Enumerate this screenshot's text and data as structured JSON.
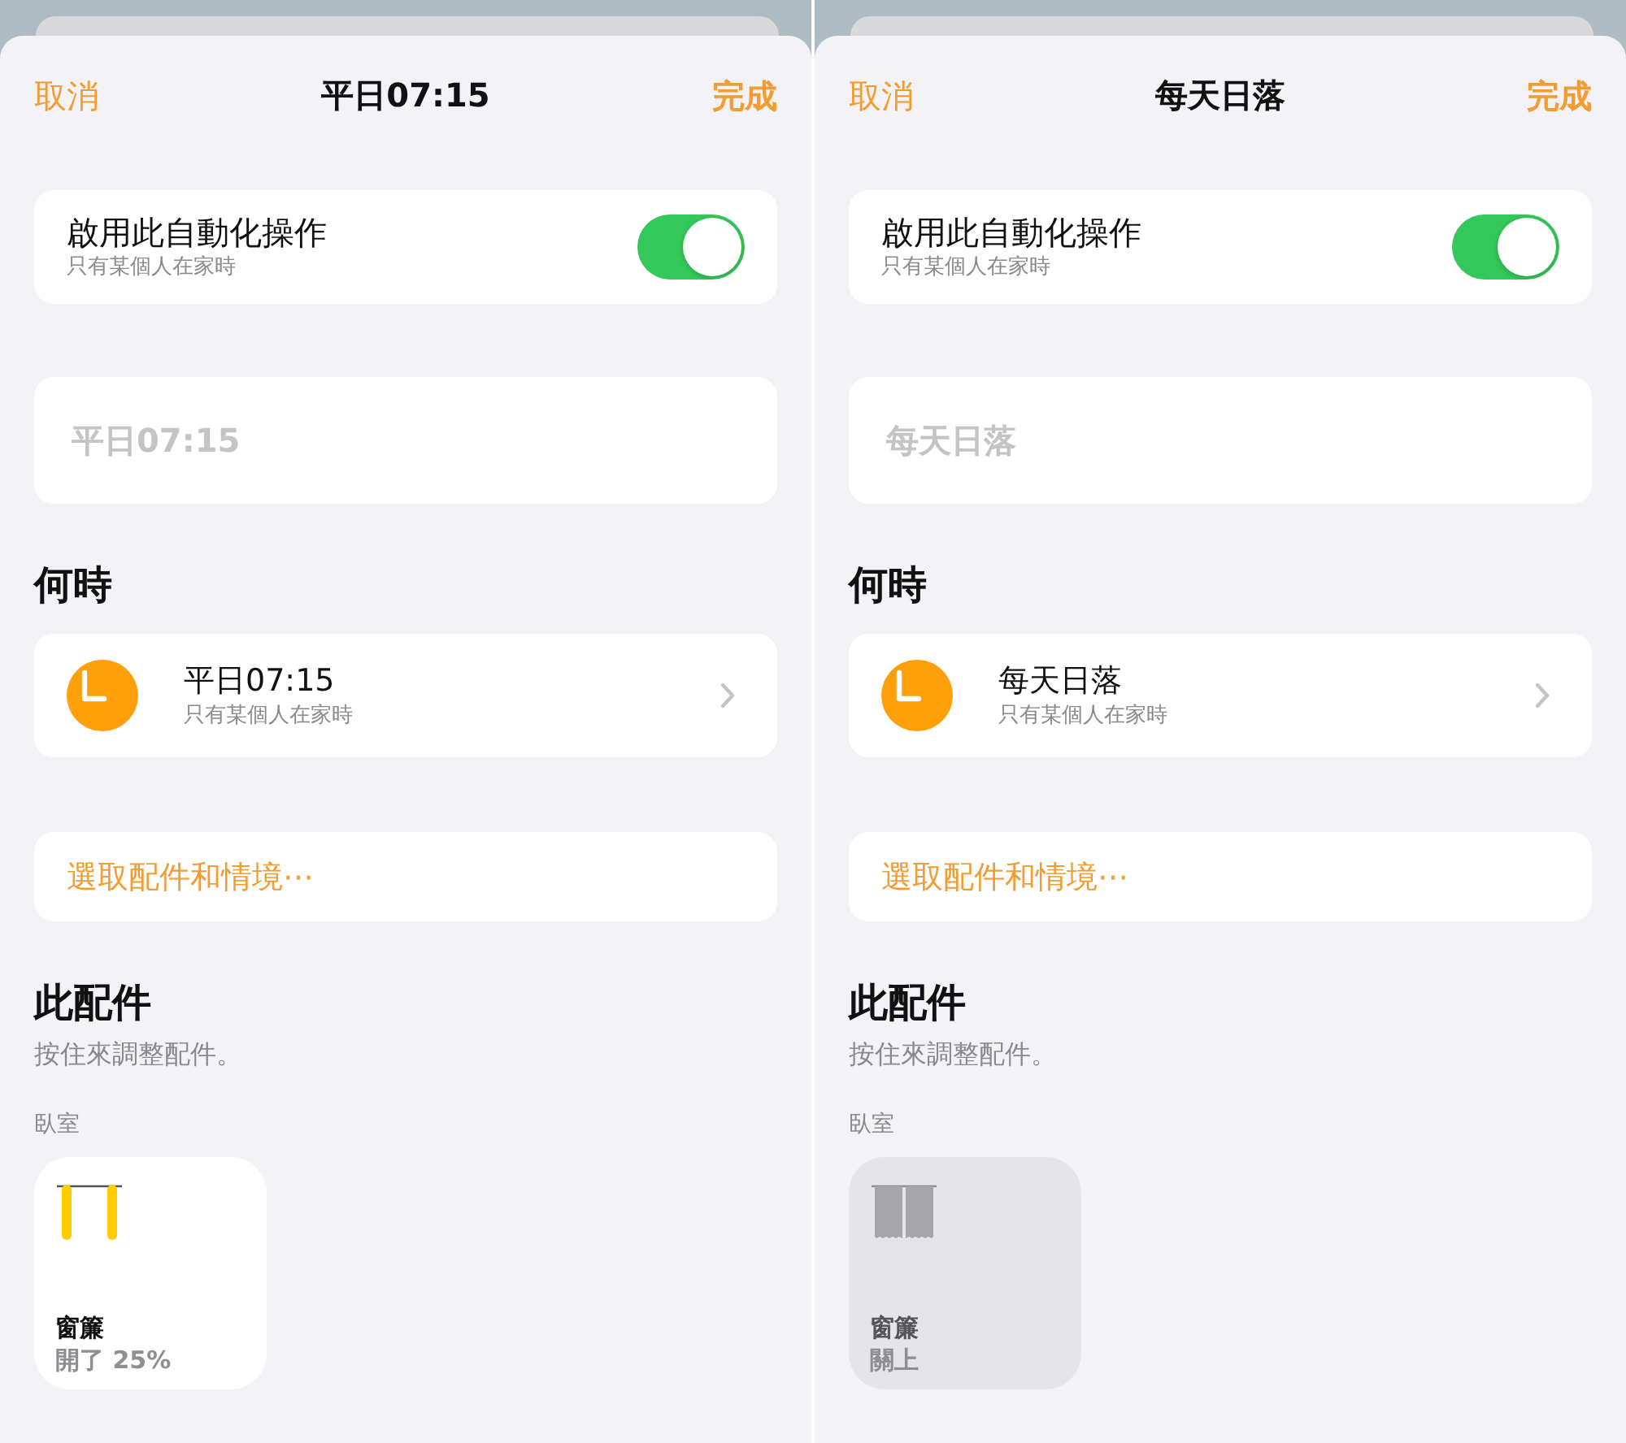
{
  "panels": [
    {
      "nav": {
        "cancel": "取消",
        "title": "平日07:15",
        "done": "完成"
      },
      "enable_row": {
        "label": "啟用此自動化操作",
        "subtitle": "只有某個人在家時",
        "on": true
      },
      "name_field": {
        "placeholder": "平日07:15"
      },
      "when": {
        "heading": "何時",
        "trigger": {
          "title": "平日07:15",
          "subtitle": "只有某個人在家時"
        }
      },
      "choose_button": {
        "label": "選取配件和情境⋯"
      },
      "accessories": {
        "heading": "此配件",
        "hint": "按住來調整配件。",
        "room": "臥室",
        "tiles": [
          {
            "name": "窗簾",
            "status": "開了 25%",
            "on": true
          }
        ]
      }
    },
    {
      "nav": {
        "cancel": "取消",
        "title": "每天日落",
        "done": "完成"
      },
      "enable_row": {
        "label": "啟用此自動化操作",
        "subtitle": "只有某個人在家時",
        "on": true
      },
      "name_field": {
        "placeholder": "每天日落"
      },
      "when": {
        "heading": "何時",
        "trigger": {
          "title": "每天日落",
          "subtitle": "只有某個人在家時"
        }
      },
      "choose_button": {
        "label": "選取配件和情境⋯"
      },
      "accessories": {
        "heading": "此配件",
        "hint": "按住來調整配件。",
        "room": "臥室",
        "tiles": [
          {
            "name": "窗簾",
            "status": "關上",
            "on": false
          }
        ]
      }
    }
  ]
}
